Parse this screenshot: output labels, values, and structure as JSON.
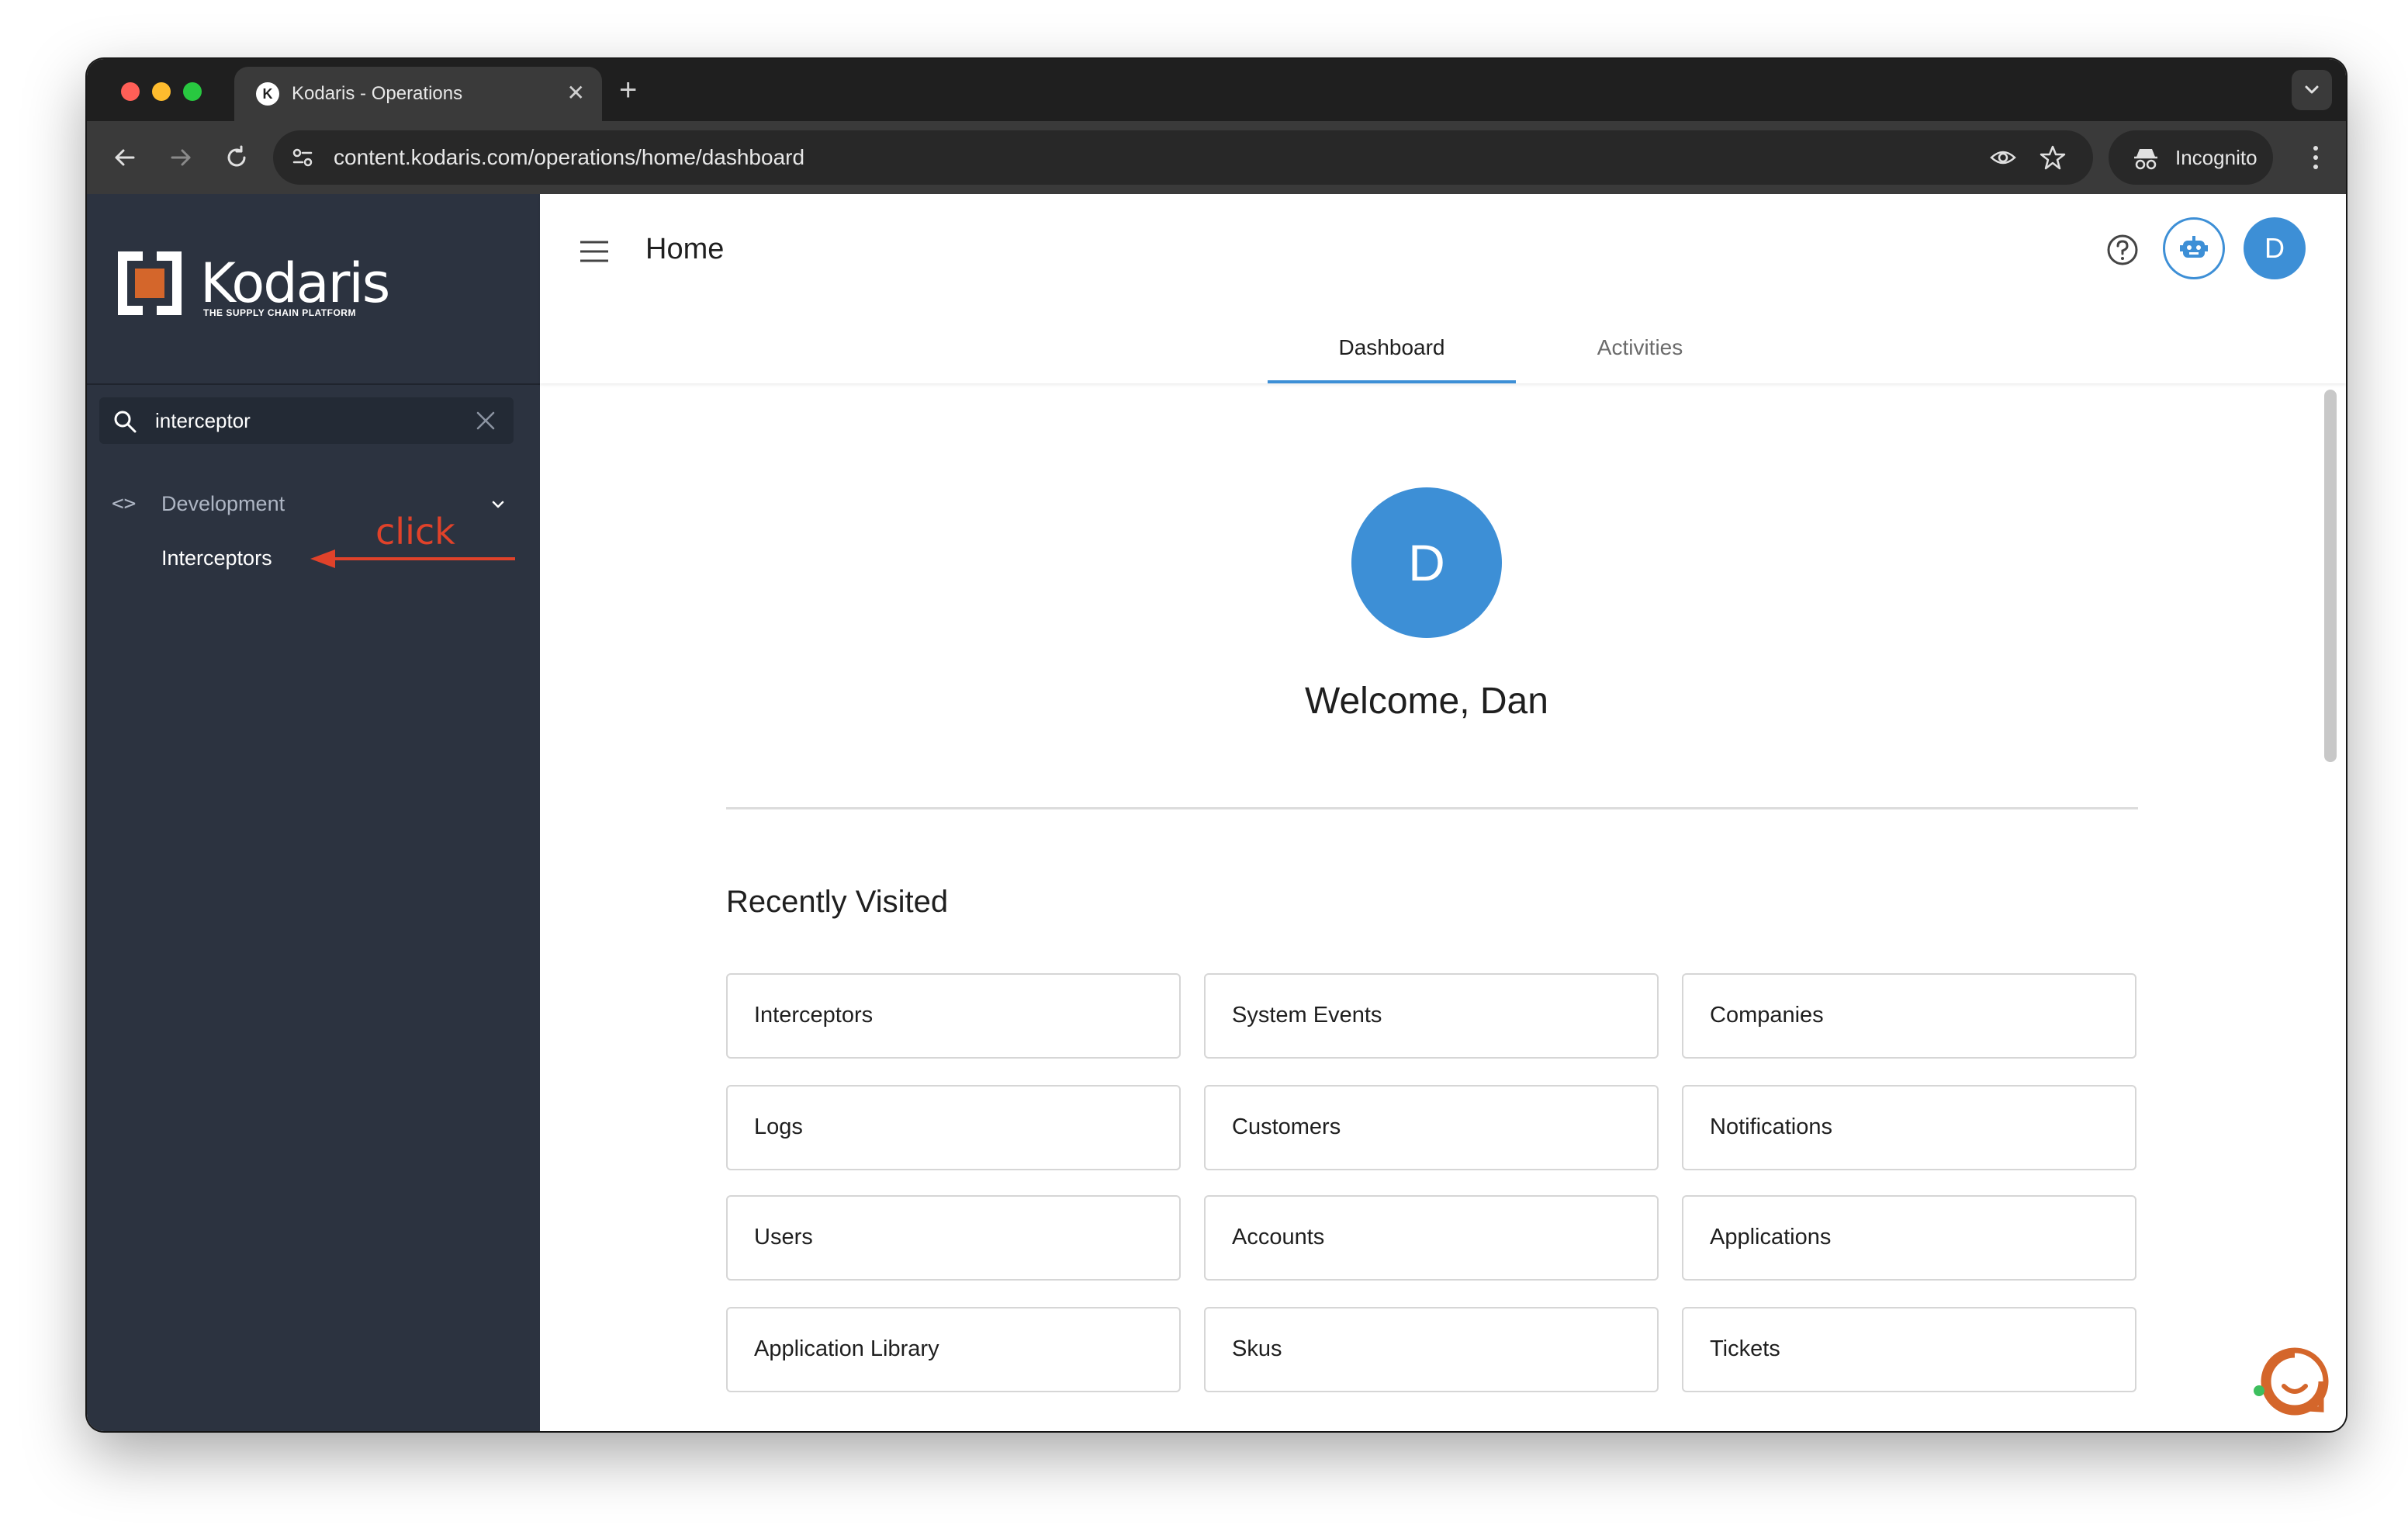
{
  "browser": {
    "tab_title": "Kodaris - Operations",
    "tab_favicon": "K",
    "url": "content.kodaris.com/operations/home/dashboard",
    "incognito_label": "Incognito"
  },
  "sidebar": {
    "logo_word": "Kodaris",
    "logo_tagline": "THE SUPPLY CHAIN PLATFORM",
    "search_value": "interceptor",
    "group_label": "Development",
    "group_icon": "<>",
    "item_label": "Interceptors",
    "annotation": "click"
  },
  "header": {
    "title": "Home",
    "avatar_initial": "D",
    "tabs": [
      {
        "label": "Dashboard",
        "active": true
      },
      {
        "label": "Activities",
        "active": false
      }
    ]
  },
  "main": {
    "avatar_initial": "D",
    "welcome": "Welcome, Dan",
    "recently_visited_title": "Recently Visited",
    "recently_visited": [
      "Interceptors",
      "System Events",
      "Companies",
      "Logs",
      "Customers",
      "Notifications",
      "Users",
      "Accounts",
      "Applications",
      "Application Library",
      "Skus",
      "Tickets"
    ]
  },
  "colors": {
    "accent": "#3d8fd6",
    "sidebar_bg": "#2c3340",
    "annotation": "#e0422a",
    "brand_orange": "#d4662b"
  }
}
